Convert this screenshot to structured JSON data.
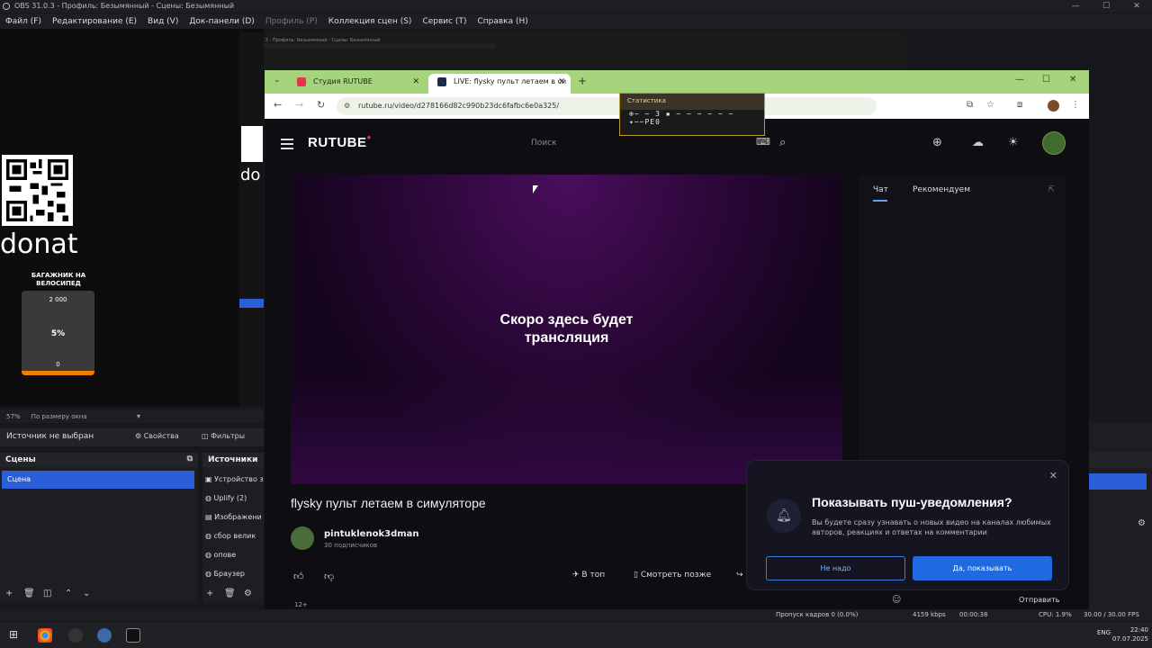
{
  "obs": {
    "title": "OBS 31.0.3 - Профиль: Безымянный - Сцены: Безымянный",
    "menu": [
      "Файл (F)",
      "Редактирование (E)",
      "Вид (V)",
      "Док-панели (D)",
      "Профиль (P)",
      "Коллекция сцен (S)",
      "Сервис (T)",
      "Справка (H)"
    ],
    "preview": {
      "donat_text": "donat",
      "nested_donat": "do",
      "goal_title": "БАГАЖНИК НА ВЕЛОСИПЕД",
      "goal_max": "2 000",
      "goal_pct": "5%",
      "goal_min": "0",
      "goal_fraction": 0.05
    },
    "zoom": "57%",
    "zoom_mode": "По размеру окна",
    "no_source": "Источник не выбран",
    "properties": "Свойства",
    "filters": "Фильтры",
    "scenes_title": "Сцены",
    "scene_item": "Сцена",
    "sources_title": "Источники",
    "sources": [
      "Устройство з",
      "Uplify (2)",
      "Изображени",
      "сбор велик",
      "опове",
      "Браузер"
    ],
    "status": {
      "dropped": "Пропуск кадров 0 (0.0%)",
      "kbps": "4159 kbps",
      "time": "00:00:38",
      "cpu": "CPU: 1.9%",
      "fps": "30.00 / 30.00 FPS"
    }
  },
  "browser": {
    "tabs": [
      {
        "label": "Студия RUTUBE"
      },
      {
        "label": "LIVE: flysky пульт летаем в си"
      }
    ],
    "url": "rutube.ru/video/d278166d82c990b23dc6fafbc6e0a325/"
  },
  "stats": {
    "title": "Статистика",
    "line1": "⊕~ ~ 3 ▪ ~ ~ ~ ~ ~ ~",
    "line2": "✦~~PE0"
  },
  "rutube": {
    "logo": "RUTUBE",
    "search_placeholder": "Поиск",
    "player_text_1": "Скоро здесь будет",
    "player_text_2": "трансляция",
    "chat_tab": "Чат",
    "rec_tab": "Рекомендуем",
    "video_title": "flysky пульт летаем в симуляторе",
    "channel_name": "pintuklenok3dman",
    "subscribers": "30 подписчиков",
    "to_top": "В топ",
    "watch_later": "Смотреть позже",
    "age": "12+",
    "send": "Отправить"
  },
  "push": {
    "title": "Показывать пуш-уведомления?",
    "text": "Вы будете сразу узнавать о новых видео на каналах любимых авторов, реакциях и ответах на комментарии",
    "no": "Не надо",
    "yes": "Да, показывать"
  },
  "tray": {
    "lang": "ENG",
    "time": "22:40",
    "date": "07.07.2025"
  }
}
